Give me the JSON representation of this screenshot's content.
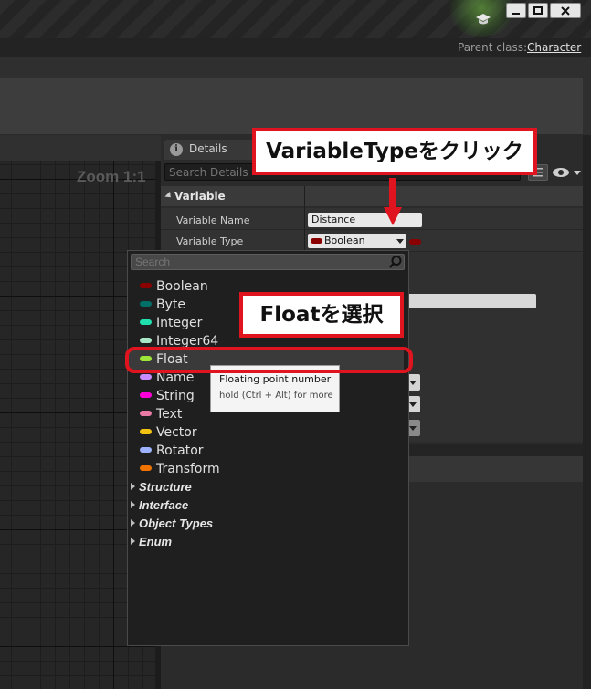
{
  "window": {
    "parent_class_label": "Parent class:",
    "parent_class_value": "Character"
  },
  "graph": {
    "zoom_label": "Zoom 1:1"
  },
  "details": {
    "tab_label": "Details",
    "search_placeholder": "Search Details",
    "section_label": "Variable",
    "rows": [
      {
        "label": "Variable Name",
        "value": "Distance"
      },
      {
        "label": "Variable Type",
        "value": "Boolean"
      }
    ]
  },
  "dropdown": {
    "search_placeholder": "Search",
    "types": [
      {
        "label": "Boolean",
        "color": "#8a0000"
      },
      {
        "label": "Byte",
        "color": "#006f65"
      },
      {
        "label": "Integer",
        "color": "#1fe0ad"
      },
      {
        "label": "Integer64",
        "color": "#a8e8c8"
      },
      {
        "label": "Float",
        "color": "#9ee53a"
      },
      {
        "label": "Name",
        "color": "#c98cff"
      },
      {
        "label": "String",
        "color": "#ff00d8"
      },
      {
        "label": "Text",
        "color": "#e87aa4"
      },
      {
        "label": "Vector",
        "color": "#f2c312"
      },
      {
        "label": "Rotator",
        "color": "#9db3ff"
      },
      {
        "label": "Transform",
        "color": "#f07300"
      }
    ],
    "categories": [
      "Structure",
      "Interface",
      "Object Types",
      "Enum"
    ]
  },
  "tooltip": {
    "line1": "Floating point number",
    "line2": "hold (Ctrl + Alt) for more"
  },
  "annotations": {
    "callout_1": "VariableTypeをクリック",
    "callout_2": "Floatを選択"
  },
  "colors": {
    "accent_red": "#e0141e"
  }
}
